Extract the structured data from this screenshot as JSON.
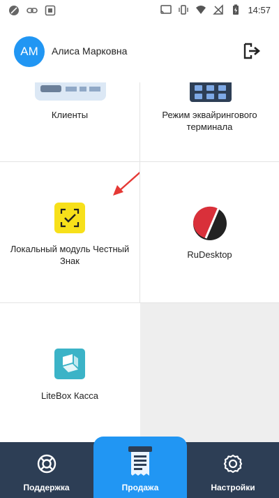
{
  "status_bar": {
    "time": "14:57",
    "left_icons": [
      "no-sim-icon",
      "link-icon",
      "screenshot-icon"
    ],
    "right_icons": [
      "cast-icon",
      "vibrate-icon",
      "wifi-icon",
      "no-signal-icon",
      "battery-charging-icon"
    ]
  },
  "header": {
    "avatar_initials": "АМ",
    "user_name": "Алиса Марковна",
    "logout_icon": "logout-icon"
  },
  "tiles": [
    {
      "label": "Клиенты",
      "icon": "clients-card-icon"
    },
    {
      "label": "Режим эквайрингового терминала",
      "icon": "terminal-keypad-icon"
    },
    {
      "label": "Локальный модуль Честный Знак",
      "icon": "chestny-znak-icon"
    },
    {
      "label": "RuDesktop",
      "icon": "rudesktop-logo-icon"
    },
    {
      "label": "LiteBox Касса",
      "icon": "litebox-logo-icon"
    }
  ],
  "bottom_nav": {
    "items": [
      {
        "label": "Поддержка",
        "icon": "lifebuoy-icon"
      },
      {
        "label": "Продажа",
        "icon": "receipt-icon"
      },
      {
        "label": "Настройки",
        "icon": "gear-icon"
      }
    ],
    "active_index": 1
  },
  "colors": {
    "accent": "#2196f3",
    "nav_background": "#2d3e55",
    "annotation_arrow": "#e53935"
  }
}
